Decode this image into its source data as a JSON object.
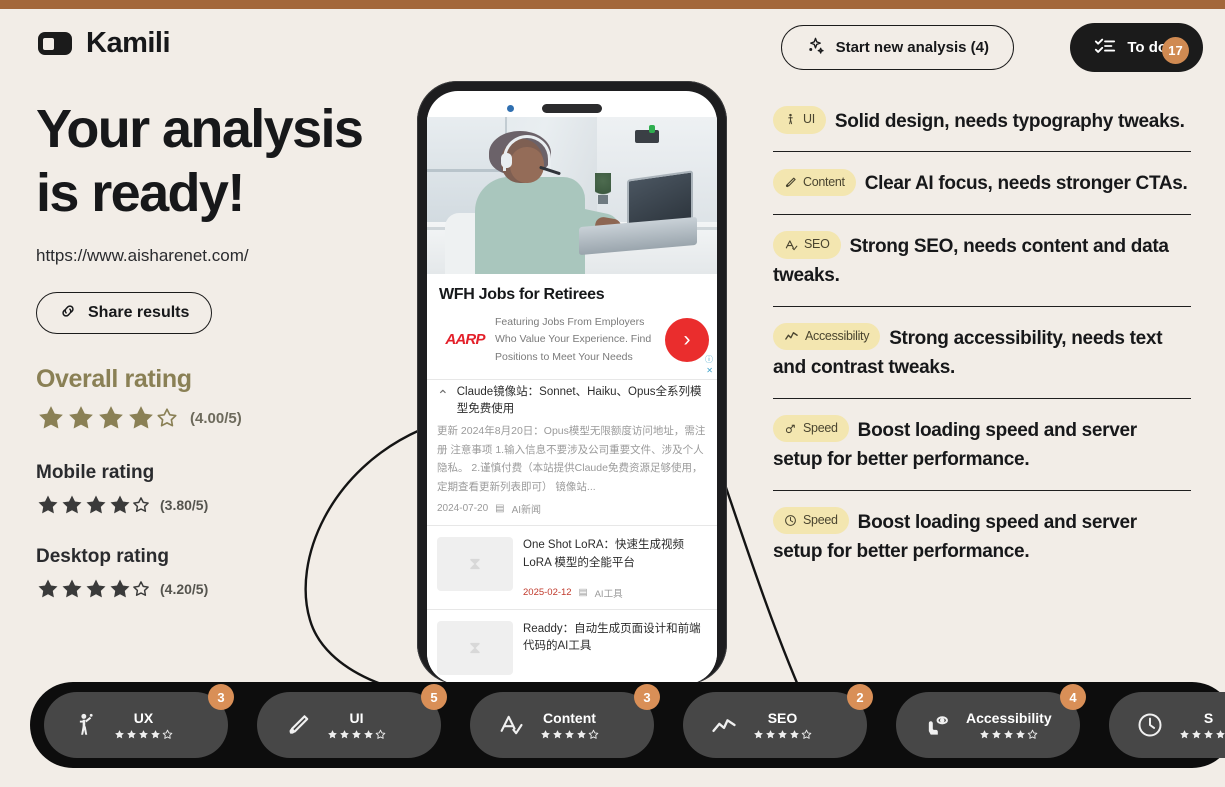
{
  "brand": {
    "name": "Kamili",
    "logo_icon": "toggle-logo-icon"
  },
  "header": {
    "new_analysis_label": "Start new analysis (4)",
    "new_analysis_icon": "sparkles-icon",
    "todos_label": "To do's",
    "todos_icon": "checklist-icon",
    "todos_badge": "17"
  },
  "left": {
    "headline_line1": "Your analysis",
    "headline_line2": "is ready!",
    "url": "https://www.aisharenet.com/",
    "share_label": "Share results",
    "share_icon": "link-icon",
    "overall": {
      "title": "Overall rating",
      "value": "(4.00/5)",
      "stars": 4,
      "max": 5
    },
    "mobile": {
      "title": "Mobile rating",
      "value": "(3.80/5)",
      "stars": 4,
      "max": 5
    },
    "desktop": {
      "title": "Desktop rating",
      "value": "(4.20/5)",
      "stars": 4,
      "max": 5
    }
  },
  "phone": {
    "ad": {
      "title": "WFH Jobs for Retirees",
      "logo": "AARP",
      "text": "Featuring Jobs From Employers Who Value Your Experience. Find Positions to Meet Your Needs",
      "cta_icon": "chevron-right-icon",
      "info_icon": "ad-info-icon",
      "close_icon": "ad-close-icon"
    },
    "post": {
      "caret_icon": "chevron-up-icon",
      "title": "Claude镜像站：Sonnet、Haiku、Opus全系列模型免费使用",
      "body": "更新 2024年8月20日：Opus模型无限额度访问地址，需注册  注意事项 1.输入信息不要涉及公司重要文件、涉及个人隐私。 2.谨慎付费（本站提供Claude免费资源足够使用，定期查看更新列表即可）  镜像站...",
      "date": "2024-07-20",
      "category": "AI新闻"
    },
    "items": [
      {
        "title": "One Shot LoRA：快速生成视频 LoRA 模型的全能平台",
        "date": "2025-02-12",
        "category": "AI工具"
      },
      {
        "title": "Readdy：自动生成页面设计和前端代码的AI工具",
        "date": "",
        "category": ""
      }
    ]
  },
  "insights": [
    {
      "tag": "UI",
      "icon": "person-icon",
      "text": "Solid design, needs typography tweaks."
    },
    {
      "tag": "Content",
      "icon": "pen-icon",
      "text": "Clear AI focus, needs stronger CTAs."
    },
    {
      "tag": "SEO",
      "icon": "a-check-icon",
      "text": "Strong SEO, needs content and data tweaks."
    },
    {
      "tag": "Accessibility",
      "icon": "chart-line-icon",
      "text": "Strong accessibility, needs text and contrast tweaks."
    },
    {
      "tag": "Speed",
      "icon": "gauge-icon",
      "text": "Boost loading speed and server setup for better performance."
    },
    {
      "tag": "Speed",
      "icon": "clock-icon",
      "text": "Boost loading speed and server setup for better performance."
    }
  ],
  "tabs": [
    {
      "label": "UX",
      "icon": "person-wave-icon",
      "badge": "3",
      "stars": 4,
      "max": 5
    },
    {
      "label": "UI",
      "icon": "pen-icon",
      "badge": "5",
      "stars": 4,
      "max": 5
    },
    {
      "label": "Content",
      "icon": "a-check-icon",
      "badge": "3",
      "stars": 4,
      "max": 5
    },
    {
      "label": "SEO",
      "icon": "chart-line-icon",
      "badge": "2",
      "stars": 4,
      "max": 5
    },
    {
      "label": "Accessibility",
      "icon": "cursor-eye-icon",
      "badge": "4",
      "stars": 4,
      "max": 5
    },
    {
      "label": "S",
      "icon": "clock-icon",
      "badge": "",
      "stars": 4,
      "max": 5
    }
  ],
  "colors": {
    "accent_bar": "#a3673a",
    "background": "#f2ede7",
    "olive": "#8a8055",
    "tag_bg": "#f3e6b0",
    "badge": "#d98f57",
    "dark": "#0d0d0d"
  }
}
